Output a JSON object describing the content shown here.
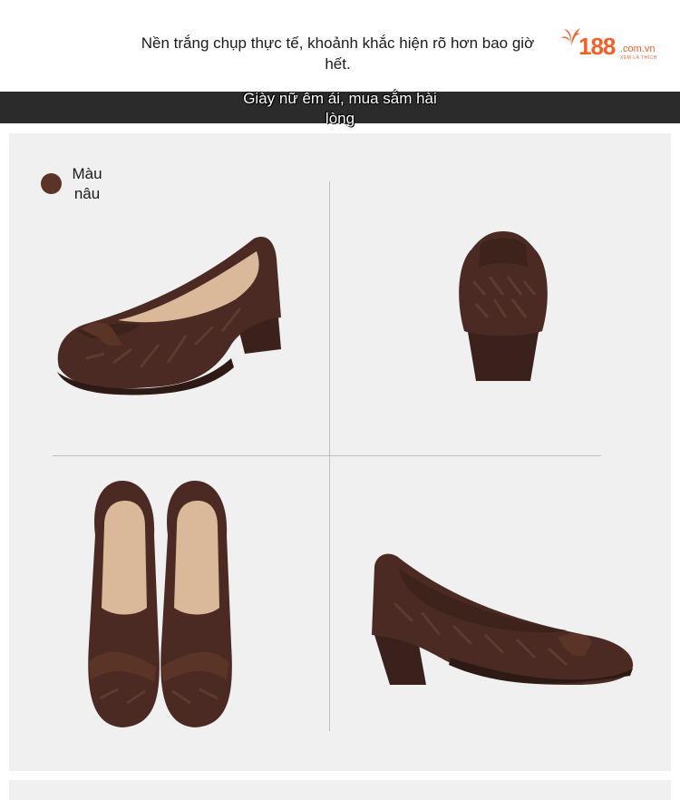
{
  "header": {
    "caption": "Nền trắng chụp thực tế, khoảnh khắc hiện rõ hơn bao giờ hết."
  },
  "logo": {
    "number": "188",
    "domain": ".com.vn",
    "tagline": "XEM LÀ THÍCH",
    "color": "#f0622a"
  },
  "banner": {
    "text": "Giày nữ êm ái, mua sắm hài lòng"
  },
  "product": {
    "color_name": "Màu nâu",
    "swatch_color": "#5a3426"
  },
  "colors": {
    "shoe_main": "#4a2a22",
    "shoe_dark": "#2e1a15",
    "insole": "#d9b99a",
    "panel_bg": "#f0f0f0"
  }
}
